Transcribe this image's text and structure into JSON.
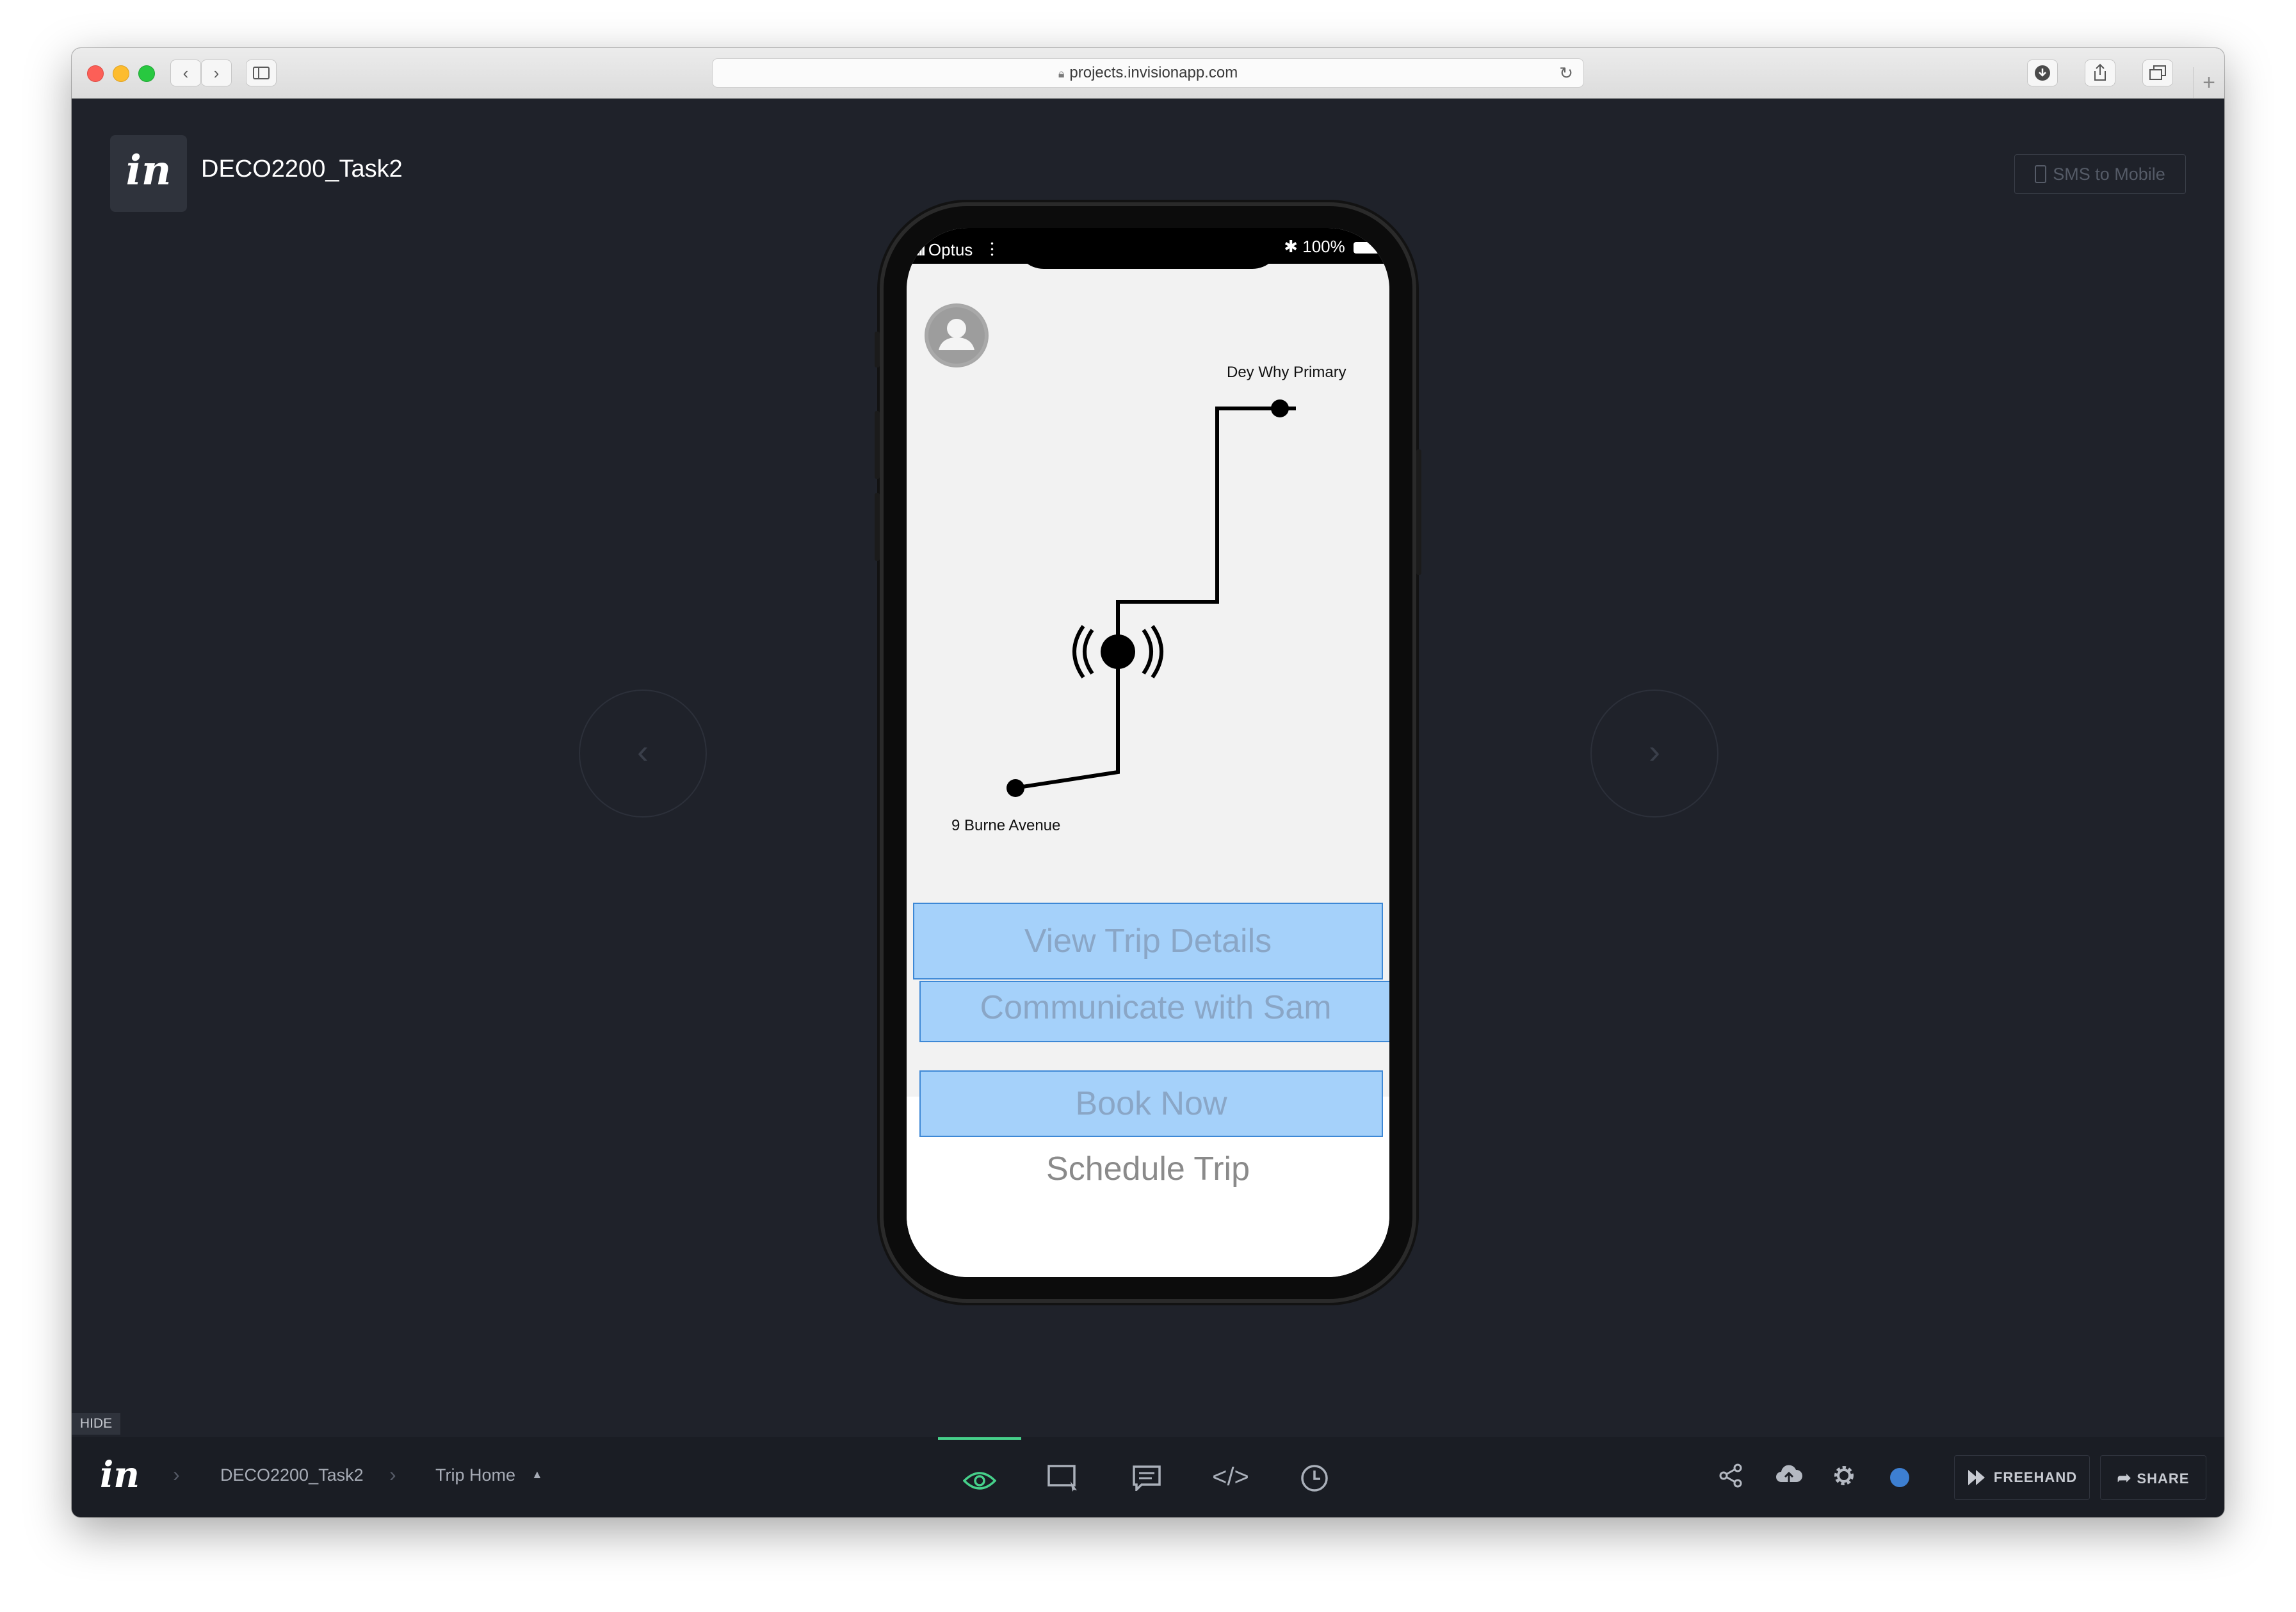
{
  "browser": {
    "url": "projects.invisionapp.com",
    "back_label": "‹",
    "forward_label": "›",
    "new_tab_label": "+"
  },
  "header": {
    "project_title": "DECO2200_Task2",
    "sms_button": "SMS to Mobile"
  },
  "phone": {
    "carrier": "Optus",
    "battery": "100%",
    "map": {
      "destination_label": "Dey Why Primary",
      "origin_label": "9 Burne Avenue"
    },
    "buttons": {
      "view_trip": "View Trip Details",
      "communicate": "Communicate with Sam",
      "book_now": "Book Now",
      "schedule": "Schedule Trip"
    }
  },
  "toolbar": {
    "hide_label": "HIDE",
    "logo": "in",
    "breadcrumb_project": "DECO2200_Task2",
    "breadcrumb_screen": "Trip Home",
    "freehand_label": "FREEHAND",
    "share_label": "SHARE",
    "active_mode": "preview",
    "accent_color": "#46d08a"
  }
}
